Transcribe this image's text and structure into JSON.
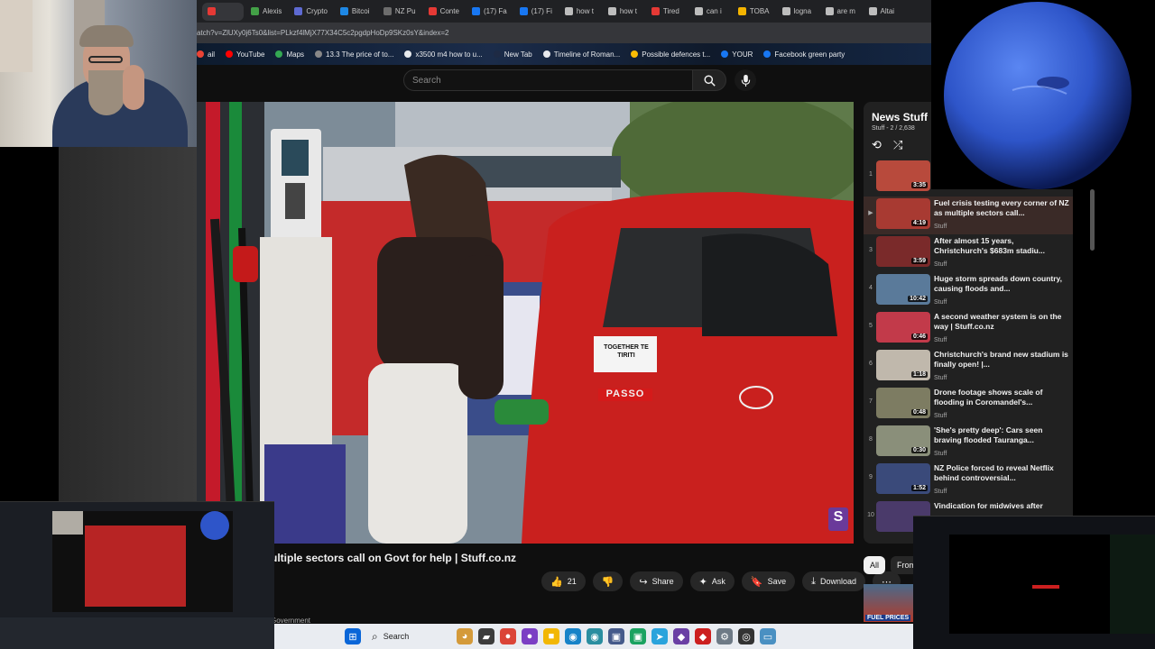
{
  "browser": {
    "tabs": [
      {
        "label": "",
        "color": "#e53935",
        "active": true
      },
      {
        "label": "Alexis",
        "color": "#43a047"
      },
      {
        "label": "Crypto",
        "color": "#5e6ad2"
      },
      {
        "label": "Bitcoi",
        "color": "#1e88e5"
      },
      {
        "label": "NZ Pu",
        "color": "#6d6d6d"
      },
      {
        "label": "Conte",
        "color": "#e53935"
      },
      {
        "label": "(17) Fa",
        "color": "#1877f2"
      },
      {
        "label": "(17) Fi",
        "color": "#1877f2"
      },
      {
        "label": "how t",
        "color": "#bdbdbd"
      },
      {
        "label": "how t",
        "color": "#bdbdbd"
      },
      {
        "label": "Tired",
        "color": "#e53935"
      },
      {
        "label": "can i",
        "color": "#bdbdbd"
      },
      {
        "label": "TOBA",
        "color": "#f4b400"
      },
      {
        "label": "logna",
        "color": "#bdbdbd"
      },
      {
        "label": "are m",
        "color": "#bdbdbd"
      },
      {
        "label": "Altai",
        "color": "#bdbdbd"
      }
    ],
    "url": "atch?v=ZlUXy0j6Ts0&list=PLkzf4lMjX77X34C5c2pgdpHoDp9SKz0sY&index=2",
    "bookmarks": [
      {
        "label": "ail",
        "color": "#ea4335"
      },
      {
        "label": "YouTube",
        "color": "#ff0000"
      },
      {
        "label": "Maps",
        "color": "#34a853"
      },
      {
        "label": "13.3 The price of to...",
        "color": "#888888"
      },
      {
        "label": "x3500 m4 how to u...",
        "color": "#e8eaed"
      },
      {
        "label": "New Tab",
        "color": "#1e2a44"
      },
      {
        "label": "Timeline of Roman...",
        "color": "#e8eaed"
      },
      {
        "label": "Possible defences t...",
        "color": "#fbbc04"
      },
      {
        "label": "YOUR",
        "color": "#1877f2"
      },
      {
        "label": "Facebook green party",
        "color": "#1877f2"
      }
    ]
  },
  "youtube": {
    "search_placeholder": "Search",
    "video_title": "ultiple sectors call on Govt for help | Stuff.co.nz",
    "likes": "21",
    "actions": {
      "share": "Share",
      "ask": "Ask",
      "save": "Save",
      "download": "Download",
      "more": "⋯"
    },
    "below_text": "Government",
    "sticker_text": "TOGETHER TE TIRITI",
    "car_badge": "PASSO",
    "watermark": "S"
  },
  "playlist": {
    "title": "News Stuff",
    "subtitle": "Stuff - 2 / 2,638",
    "items": [
      {
        "num": "1",
        "title": "",
        "channel": "",
        "duration": "3:35",
        "thumb": "#b84a3c"
      },
      {
        "num": "▶",
        "title": "Fuel crisis testing every corner of NZ as multiple sectors call...",
        "channel": "Stuff",
        "duration": "4:19",
        "thumb": "#a83a32",
        "active": true
      },
      {
        "num": "3",
        "title": "After almost 15 years, Christchurch's $683m stadiu...",
        "channel": "Stuff",
        "duration": "3:59",
        "thumb": "#7a2a2a"
      },
      {
        "num": "4",
        "title": "Huge storm spreads down country, causing floods and...",
        "channel": "Stuff",
        "duration": "10:42",
        "thumb": "#5a7a9a"
      },
      {
        "num": "5",
        "title": "A second weather system is on the way | Stuff.co.nz",
        "channel": "Stuff",
        "duration": "0:46",
        "thumb": "#c23a4a"
      },
      {
        "num": "6",
        "title": "Christchurch's brand new stadium is finally open! |...",
        "channel": "Stuff",
        "duration": "1:18",
        "thumb": "#c0b8ac"
      },
      {
        "num": "7",
        "title": "Drone footage shows scale of flooding in Coromandel's...",
        "channel": "Stuff",
        "duration": "0:48",
        "thumb": "#7d7c62"
      },
      {
        "num": "8",
        "title": "'She's pretty deep': Cars seen braving flooded Tauranga...",
        "channel": "Stuff",
        "duration": "0:30",
        "thumb": "#8a8f7a"
      },
      {
        "num": "9",
        "title": "NZ Police forced to reveal Netflix behind controversial...",
        "channel": "Stuff",
        "duration": "1:52",
        "thumb": "#3a4a7a"
      },
      {
        "num": "10",
        "title": "Vindication for midwives after",
        "channel": "",
        "duration": "",
        "thumb": "#4a3a6a"
      }
    ],
    "chips": [
      "All",
      "From"
    ],
    "rec_label": "FUEL PRICES"
  },
  "taskbar": {
    "search_label": "Search",
    "icons": [
      {
        "name": "windows-start-icon",
        "glyph": "⊞",
        "color": "#0a66d8"
      },
      {
        "name": "widgets-icon",
        "glyph": "◕",
        "color": "#d49a3a"
      },
      {
        "name": "file-explorer-icon",
        "glyph": "▰",
        "color": "#3c3c3c"
      },
      {
        "name": "chrome-icon",
        "glyph": "●",
        "color": "#db4437"
      },
      {
        "name": "chrome-profile-icon",
        "glyph": "●",
        "color": "#7b3fc4"
      },
      {
        "name": "folder-icon",
        "glyph": "■",
        "color": "#f2b705"
      },
      {
        "name": "edge-icon",
        "glyph": "◉",
        "color": "#1783c8"
      },
      {
        "name": "edge-beta-icon",
        "glyph": "◉",
        "color": "#2a8ea0"
      },
      {
        "name": "app-icon",
        "glyph": "▣",
        "color": "#455a8a"
      },
      {
        "name": "green-app-icon",
        "glyph": "▣",
        "color": "#1aa260"
      },
      {
        "name": "telegram-icon",
        "glyph": "➤",
        "color": "#2aa3dc"
      },
      {
        "name": "purple-app-icon",
        "glyph": "◆",
        "color": "#6a3fa4"
      },
      {
        "name": "red-app-icon",
        "glyph": "◆",
        "color": "#cc1f1f"
      },
      {
        "name": "settings-icon",
        "glyph": "⚙",
        "color": "#6e7a86"
      },
      {
        "name": "obs-icon",
        "glyph": "◎",
        "color": "#333333"
      },
      {
        "name": "screen-app-icon",
        "glyph": "▭",
        "color": "#4a90c2"
      }
    ]
  },
  "colors": {
    "youtube_bg": "#0f0f0f",
    "accent_red": "#ff0000"
  }
}
